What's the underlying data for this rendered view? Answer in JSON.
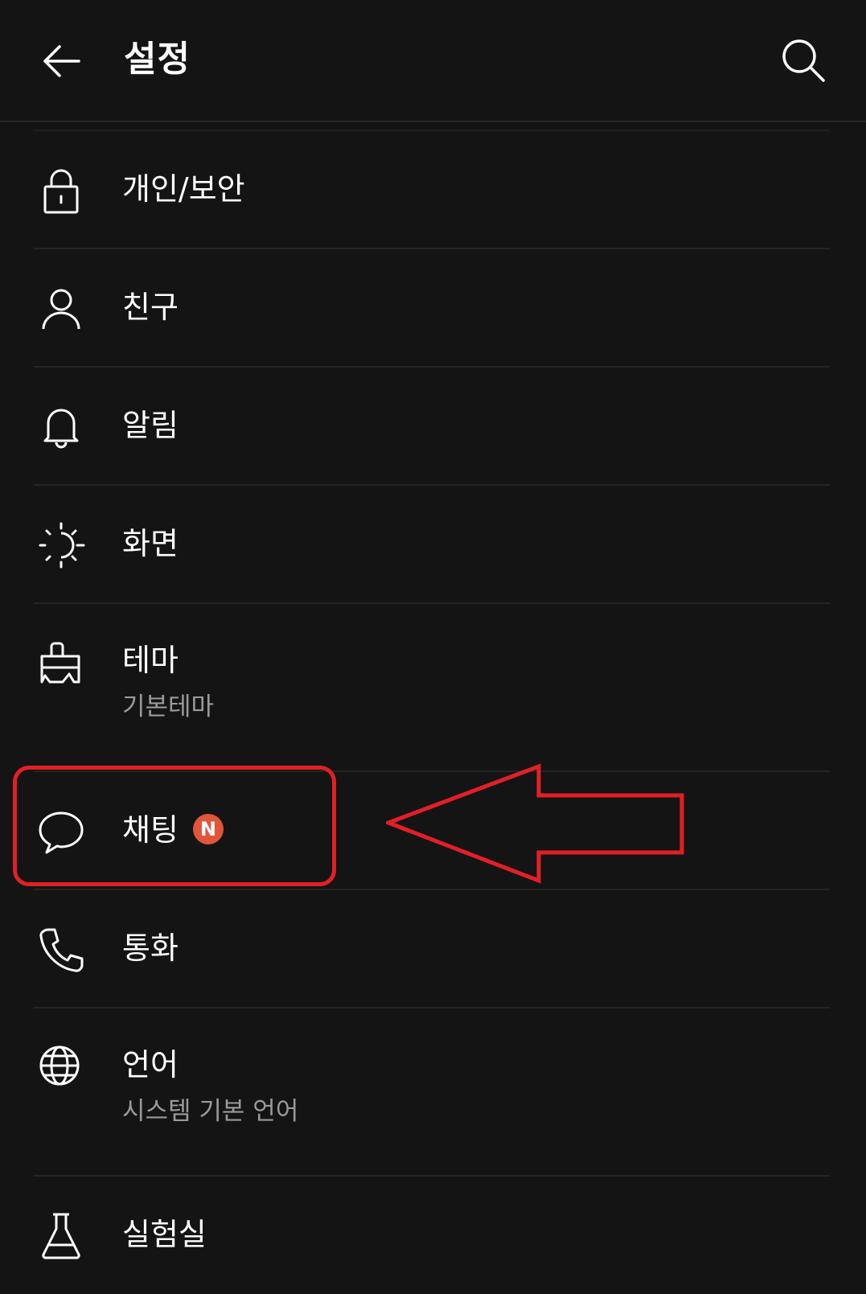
{
  "header": {
    "title": "설정"
  },
  "menu": [
    {
      "key": "privacy",
      "label": "개인/보안",
      "icon": "lock-icon"
    },
    {
      "key": "friends",
      "label": "친구",
      "icon": "person-icon"
    },
    {
      "key": "notifications",
      "label": "알림",
      "icon": "bell-icon"
    },
    {
      "key": "display",
      "label": "화면",
      "icon": "brightness-icon"
    },
    {
      "key": "theme",
      "label": "테마",
      "sublabel": "기본테마",
      "icon": "paint-brush-icon"
    },
    {
      "key": "chat",
      "label": "채팅",
      "badge": "N",
      "icon": "chat-bubble-icon"
    },
    {
      "key": "call",
      "label": "통화",
      "icon": "phone-icon"
    },
    {
      "key": "language",
      "label": "언어",
      "sublabel": "시스템 기본 언어",
      "icon": "globe-icon"
    },
    {
      "key": "lab",
      "label": "실험실",
      "icon": "flask-icon"
    }
  ],
  "colors": {
    "background": "#141414",
    "badge": "#e2553b",
    "annotation": "#e31f26",
    "sublabel": "#9a9a9a"
  }
}
